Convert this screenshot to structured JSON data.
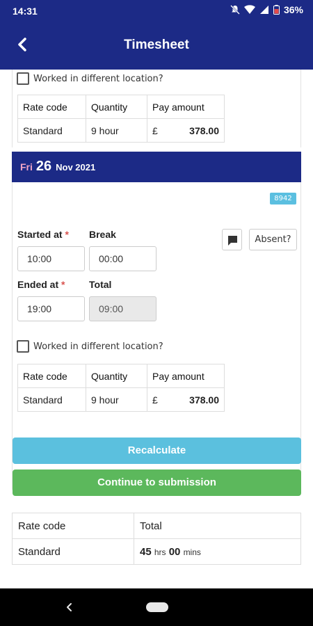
{
  "status_bar": {
    "time": "14:31",
    "battery": "36%"
  },
  "app_bar": {
    "title": "Timesheet"
  },
  "prev_entry": {
    "location_label": "Worked in different location?",
    "table_headers": [
      "Rate code",
      "Quantity",
      "Pay amount"
    ],
    "row": {
      "rate_code": "Standard",
      "quantity": "9 hour",
      "currency": "£",
      "amount": "378.00"
    }
  },
  "day": {
    "dow": "Fri",
    "day_num": "26",
    "month_year": "Nov 2021",
    "badge": "8942",
    "started_label": "Started at",
    "break_label": "Break",
    "ended_label": "Ended at",
    "total_label": "Total",
    "required_mark": "*",
    "started_value": "10:00",
    "break_value": "00:00",
    "ended_value": "19:00",
    "total_value": "09:00",
    "absent_label": "Absent?",
    "location_label": "Worked in different location?",
    "table_headers": [
      "Rate code",
      "Quantity",
      "Pay amount"
    ],
    "row": {
      "rate_code": "Standard",
      "quantity": "9 hour",
      "currency": "£",
      "amount": "378.00"
    }
  },
  "actions": {
    "recalculate": "Recalculate",
    "continue": "Continue to submission"
  },
  "summary": {
    "headers": [
      "Rate code",
      "Total"
    ],
    "row": {
      "rate_code": "Standard",
      "hours": "45",
      "hrs_unit": "hrs",
      "mins": "00",
      "mins_unit": "mins"
    }
  },
  "colors": {
    "primary": "#1c2a86",
    "info": "#5bc0de",
    "success": "#5cb85c",
    "badge": "#5bbfe0"
  }
}
